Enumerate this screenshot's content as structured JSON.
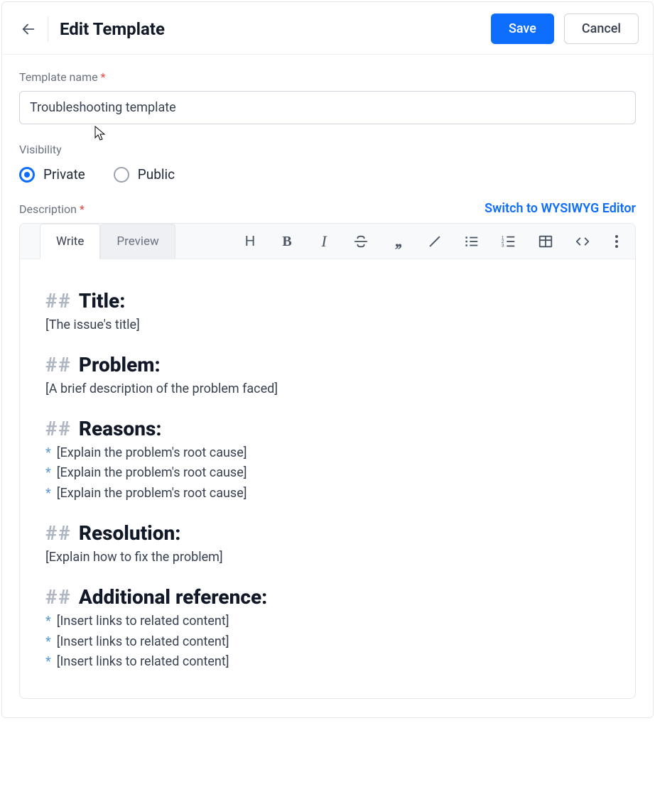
{
  "header": {
    "title": "Edit Template",
    "save_label": "Save",
    "cancel_label": "Cancel"
  },
  "fields": {
    "template_name_label": "Template name",
    "template_name_value": "Troubleshooting template",
    "visibility_label": "Visibility",
    "visibility_options": {
      "private": "Private",
      "public": "Public"
    },
    "visibility_selected": "private",
    "description_label": "Description",
    "switch_editor_label": "Switch to WYSIWYG Editor"
  },
  "editor": {
    "tabs": {
      "write": "Write",
      "preview": "Preview",
      "active": "write"
    },
    "content": {
      "sections": [
        {
          "heading": "Title:",
          "lines": [
            "[The issue's title]"
          ]
        },
        {
          "heading": "Problem:",
          "lines": [
            "[A brief description of the problem faced]"
          ]
        },
        {
          "heading": "Reasons:",
          "bullets": [
            "[Explain the problem's root cause]",
            "[Explain the problem's root cause]",
            "[Explain the problem's root cause]"
          ]
        },
        {
          "heading": "Resolution:",
          "lines": [
            "[Explain how to fix the problem]"
          ]
        },
        {
          "heading": "Additional reference:",
          "bullets": [
            "[Insert links to related content]",
            "[Insert links to related content]",
            "[Insert links to related content]"
          ]
        }
      ]
    }
  }
}
